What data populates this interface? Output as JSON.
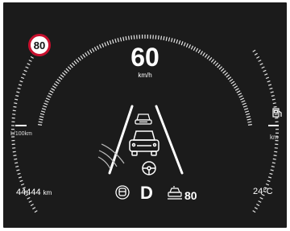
{
  "speed_limit": "80",
  "speed": {
    "value": "60",
    "unit": "km/h"
  },
  "left_gauge": {
    "label": "L/100km",
    "value": "—"
  },
  "right_gauge": {
    "icon": "fuel-pump-icon",
    "label": "km",
    "value": "—"
  },
  "odometer": {
    "value": "44444",
    "unit": "km"
  },
  "gear": "D",
  "acc": {
    "icon": "adaptive-cruise-icon",
    "set_speed": "80"
  },
  "temperature": "24°C",
  "indicators": [
    "lane-keeping-icon",
    "steering-wheel-icon",
    "driver-attention-icon"
  ],
  "colors": {
    "background": "#1b1b1b",
    "foreground": "#ffffff",
    "limit_ring": "#c8102e"
  }
}
